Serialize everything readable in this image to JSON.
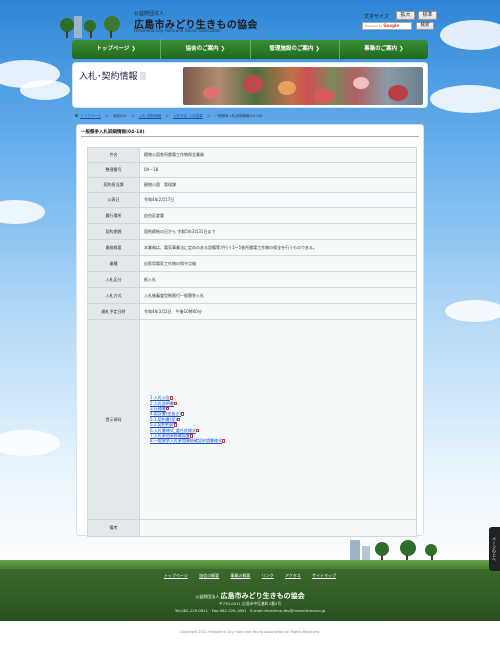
{
  "header": {
    "org_type": "公益財団法人",
    "org_name": "広島市みどり生きもの協会",
    "org_name_en": "Hiroshima City Flora and Fauna Association",
    "font_size_label": "文字サイズ",
    "font_large": "拡大",
    "font_standard": "標準",
    "search_placeholder": "Powered by",
    "search_brand": "Google",
    "search_button": "検索"
  },
  "nav": [
    "トップページ ❯",
    "協会のご案内 ❯",
    "管理施設のご案内 ❯",
    "事業のご案内 ❯"
  ],
  "banner": {
    "title": "入札･契約情報"
  },
  "breadcrumb": [
    "トップページ",
    "＞",
    "本部ほか",
    "＞",
    "入札･契約情報",
    "＞",
    "入札予定･入札結果",
    "＞",
    "一般競争入札詳細情報(04-18)"
  ],
  "section": {
    "title": "一般競争入札詳細情報(04-18)"
  },
  "table": [
    {
      "label": "件名",
      "value": "植物公園各所雷電工作物保全業務"
    },
    {
      "label": "整理番号",
      "value": "04－18"
    },
    {
      "label": "契約担当課",
      "value": "植物公園　管理課"
    },
    {
      "label": "公表日",
      "value": "令和4年2月17日"
    },
    {
      "label": "履行場所",
      "value": "佐伯区倉重"
    },
    {
      "label": "契約期間",
      "value": "契約締結の日から 令和5年3月31日まで"
    },
    {
      "label": "業務概要",
      "value": "本業務は、電気事業法に定めのある設備等が行う1～5各所雷電工作物の保全を行うものである。"
    },
    {
      "label": "業種",
      "value": "自家用電気工作物の保守点検"
    },
    {
      "label": "入札区分",
      "value": "紙入札"
    },
    {
      "label": "入札方式",
      "value": "入札後審査型制限付一般競争入札"
    },
    {
      "label": "開札予定日時",
      "value": "令和4年3月2日　午後10時00分"
    }
  ],
  "documents": {
    "label": "提示資料",
    "items": [
      "1.入札公告",
      "2.入札説明書",
      "3.仕様書",
      "4.設計書(金抜き)",
      "5-1.契約書(案)",
      "5-2.契約約款",
      "6.入札書様式_委任状様式",
      "7.入札参加資格確認書",
      "8.一般競争入札参加資格確認申請書様式"
    ]
  },
  "note_label": "備考",
  "footer": {
    "links": [
      "トップページ",
      "協会の概要",
      "事業の概要",
      "リンク",
      "アクセス",
      "サイトマップ"
    ],
    "org_type": "公益財団法人",
    "org_name": "広島市みどり生きもの協会",
    "address": "〒730-0011 広島市中区基町4番4号",
    "contact": "Tel:082-229-0811　Fax:082-229-1891　E-mail:hiroshima-fbv@midoriikimono.jp",
    "copyright": "Copyright 2011 Hiroshima City Flora and Fauna Association All Rights Reserved."
  },
  "pagetop": "ページの上へ"
}
